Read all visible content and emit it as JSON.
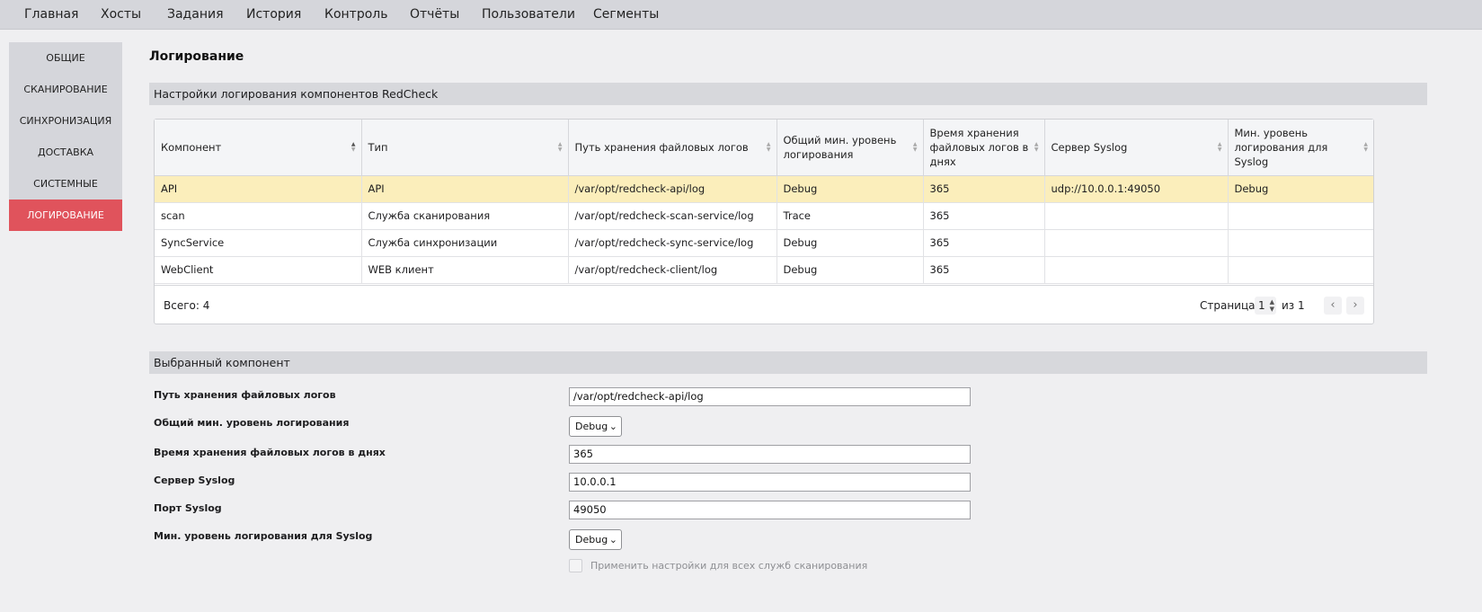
{
  "nav": {
    "items": [
      "Главная",
      "Хосты",
      "Задания",
      "История",
      "Контроль",
      "Отчёты",
      "Пользователи",
      "Сегменты"
    ]
  },
  "sidebar": {
    "items": [
      "ОБЩИЕ",
      "СКАНИРОВАНИЕ",
      "СИНХРОНИЗАЦИЯ",
      "ДОСТАВКА",
      "СИСТЕМНЫЕ",
      "ЛОГИРОВАНИЕ"
    ],
    "active_index": 5
  },
  "page": {
    "title": "Логирование"
  },
  "components_section": {
    "title": "Настройки логирования компонентов RedCheck"
  },
  "table": {
    "headers": [
      "Компонент",
      "Тип",
      "Путь хранения файловых логов",
      "Общий мин. уровень логирования",
      "Время хранения файловых логов в днях",
      "Сервер Syslog",
      "Мин. уровень логирования для Syslog"
    ],
    "rows": [
      [
        "API",
        "API",
        "/var/opt/redcheck-api/log",
        "Debug",
        "365",
        "udp://10.0.0.1:49050",
        "Debug"
      ],
      [
        "scan",
        "Служба сканирования",
        "/var/opt/redcheck-scan-service/log",
        "Trace",
        "365",
        "",
        ""
      ],
      [
        "SyncService",
        "Служба синхронизации",
        "/var/opt/redcheck-sync-service/log",
        "Debug",
        "365",
        "",
        ""
      ],
      [
        "WebClient",
        "WEB клиент",
        "/var/opt/redcheck-client/log",
        "Debug",
        "365",
        "",
        ""
      ]
    ],
    "selected_row": 0,
    "total": "Всего: 4",
    "pager": {
      "label": "Страница",
      "page": "1",
      "of": "из 1"
    }
  },
  "selected_section": {
    "title": "Выбранный компонент"
  },
  "form": {
    "path_label": "Путь хранения файловых логов",
    "path_value": "/var/opt/redcheck-api/log",
    "level_label": "Общий мин. уровень логирования",
    "level_value": "Debug",
    "retention_label": "Время хранения файловых логов в днях",
    "retention_value": "365",
    "syslog_server_label": "Сервер Syslog",
    "syslog_server_value": "10.0.0.1",
    "syslog_port_label": "Порт Syslog",
    "syslog_port_value": "49050",
    "syslog_level_label": "Мин. уровень логирования для Syslog",
    "syslog_level_value": "Debug",
    "apply_all_label": "Применить настройки для всех служб сканирования"
  },
  "colors": {
    "accent": "#e0535c",
    "selected_row": "#fbeebb",
    "nav_bg": "#d5d6db"
  },
  "icons": {
    "sort": "sort-arrows-icon",
    "chevron_left": "chevron-left-icon",
    "chevron_right": "chevron-right-icon",
    "select_caret": "chevron-down-icon"
  }
}
